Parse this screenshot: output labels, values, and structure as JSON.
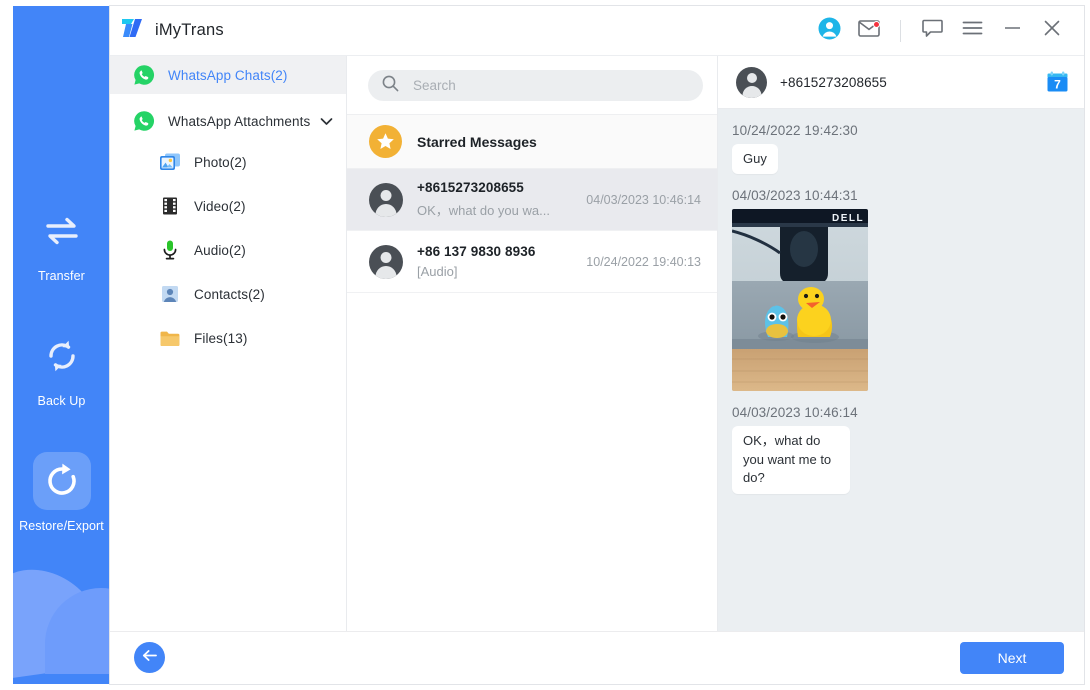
{
  "app": {
    "title": "iMyTrans",
    "logo_icon": "imytrans-logo-icon"
  },
  "titlebar": {
    "account_icon": "account-avatar-icon",
    "mail_icon": "envelope-icon",
    "feedback_icon": "speech-bubble-icon",
    "menu_icon": "hamburger-menu-icon",
    "minimize_icon": "minimize-icon",
    "close_icon": "close-icon"
  },
  "rail": {
    "items": [
      {
        "label": "Transfer",
        "icon": "transfer-arrows-icon",
        "active": false
      },
      {
        "label": "Back Up",
        "icon": "backup-refresh-icon",
        "active": false
      },
      {
        "label": "Restore/Export",
        "icon": "restore-export-icon",
        "active": true
      }
    ]
  },
  "nav": {
    "chats": {
      "label": "WhatsApp Chats(2)",
      "icon": "whatsapp-icon",
      "selected": true
    },
    "attachments": {
      "label": "WhatsApp Attachments",
      "icon": "whatsapp-icon",
      "chevron": "chevron-down-icon"
    },
    "sub_items": [
      {
        "label": "Photo(2)",
        "icon": "photo-icon"
      },
      {
        "label": "Video(2)",
        "icon": "video-film-icon"
      },
      {
        "label": "Audio(2)",
        "icon": "microphone-icon"
      },
      {
        "label": "Contacts(2)",
        "icon": "contacts-person-icon"
      },
      {
        "label": "Files(13)",
        "icon": "folder-icon"
      }
    ]
  },
  "search": {
    "placeholder": "Search",
    "value": "",
    "icon": "search-icon"
  },
  "list": {
    "starred": {
      "label": "Starred Messages",
      "icon": "star-icon"
    },
    "rows": [
      {
        "name": "+8615273208655",
        "preview": "OK，what do you wa...",
        "time": "04/03/2023 10:46:14",
        "selected": true
      },
      {
        "name": "+86 137 9830 8936",
        "preview": "[Audio]",
        "time": "10/24/2022 19:40:13",
        "selected": false
      }
    ]
  },
  "conversation": {
    "header_title": "+8615273208655",
    "calendar_icon": "calendar-icon",
    "calendar_day": "7",
    "messages": [
      {
        "time": "10/24/2022 19:42:30",
        "type": "text",
        "text": "Guy"
      },
      {
        "time": "04/03/2023 10:44:31",
        "type": "image",
        "alt": "photo of yellow rubber duck and blue toy in front of a Dell monitor"
      },
      {
        "time": "04/03/2023 10:46:14",
        "type": "text",
        "text": "OK，what do you want me to do?"
      }
    ]
  },
  "footer": {
    "back_icon": "back-arrow-icon",
    "next_label": "Next"
  },
  "colors": {
    "accent": "#4285f8",
    "whatsapp_green": "#25d366",
    "star_amber": "#f2b135",
    "chat_bg": "#ebeff2",
    "badge_red": "#f5333f"
  }
}
